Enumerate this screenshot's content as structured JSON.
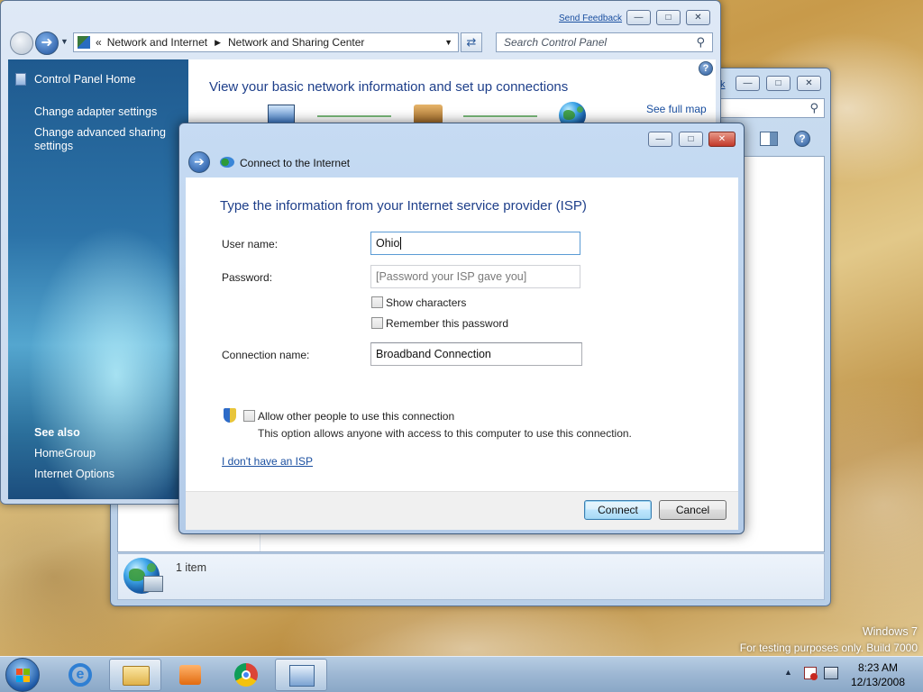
{
  "back_window": {
    "status_text": "1 item",
    "partial_link": "k"
  },
  "control_panel": {
    "send_feedback": "Send Feedback",
    "breadcrumb_separator": "«",
    "breadcrumb": [
      "Network and Internet",
      "Network and Sharing Center"
    ],
    "search_placeholder": "Search Control Panel",
    "nav_home": "Control Panel Home",
    "nav_links": [
      "Change adapter settings",
      "Change advanced sharing settings"
    ],
    "see_also_heading": "See also",
    "see_also_links": [
      "HomeGroup",
      "Internet Options"
    ],
    "heading": "View your basic network information and set up connections",
    "see_full_map": "See full map"
  },
  "dialog": {
    "title": "Connect to the Internet",
    "heading": "Type the information from your Internet service provider (ISP)",
    "username_label": "User name:",
    "username_value": "Ohio",
    "password_label": "Password:",
    "password_placeholder": "[Password your ISP gave you]",
    "show_characters": "Show characters",
    "remember_password": "Remember this password",
    "connection_name_label": "Connection name:",
    "connection_name_value": "Broadband Connection",
    "allow_others": "Allow other people to use this connection",
    "allow_others_desc": "This option allows anyone with access to this computer to use this connection.",
    "no_isp_link": "I don't have an ISP",
    "connect_button": "Connect",
    "cancel_button": "Cancel"
  },
  "desktop": {
    "watermark_line1": "Windows 7",
    "watermark_line2": "For testing purposes only. Build 7000"
  },
  "taskbar": {
    "time": "8:23 AM",
    "date": "12/13/2008"
  },
  "colors": {
    "link": "#1a4fa0",
    "dialog_heading": "#1e3f8a",
    "cp_heading": "#1e3f8a"
  }
}
